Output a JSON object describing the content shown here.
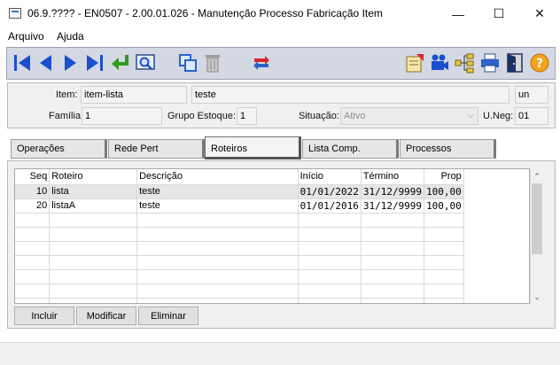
{
  "window": {
    "title": "06.9.???? - EN0507 - 2.00.01.026 - Manutenção Processo Fabricação Item",
    "minimize": "—",
    "maximize": "☐",
    "close": "✕"
  },
  "menu": [
    "Arquivo",
    "Ajuda"
  ],
  "toolbar": {
    "left_icons": [
      "first-record-icon",
      "previous-record-icon",
      "next-record-icon",
      "last-record-icon",
      "goto-icon",
      "search-icon",
      "copy-icon",
      "delete-icon",
      "swap-icon"
    ],
    "right_icons": [
      "report-icon",
      "camera-icon",
      "tree-icon",
      "print-icon",
      "exit-door-icon",
      "help-icon"
    ]
  },
  "header": {
    "item_label": "Item:",
    "item_code": "item-lista",
    "item_desc": "teste",
    "unit": "un",
    "familia_label": "Família:",
    "familia_value": "1",
    "grupo_label": "Grupo Estoque:",
    "grupo_value": "1",
    "situacao_label": "Situação:",
    "situacao_value": "Ativo",
    "uneg_label": "U.Neg:",
    "uneg_value": "01"
  },
  "tabs": [
    "Operações",
    "Rede Pert",
    "Roteiros",
    "Lista Comp.",
    "Processos"
  ],
  "active_tab": "Roteiros",
  "grid": {
    "columns": [
      "Seq",
      "Roteiro",
      "Descrição",
      "Início",
      "Término",
      "Prop"
    ],
    "rows": [
      {
        "seq": "10",
        "roteiro": "lista",
        "descricao": "teste",
        "inicio": "01/01/2022",
        "termino": "31/12/9999",
        "prop": "100,00"
      },
      {
        "seq": "20",
        "roteiro": "listaA",
        "descricao": "teste",
        "inicio": "01/01/2016",
        "termino": "31/12/9999",
        "prop": "100,00"
      }
    ]
  },
  "buttons": {
    "incluir": "Incluir",
    "modificar": "Modificar",
    "eliminar": "Eliminar"
  }
}
